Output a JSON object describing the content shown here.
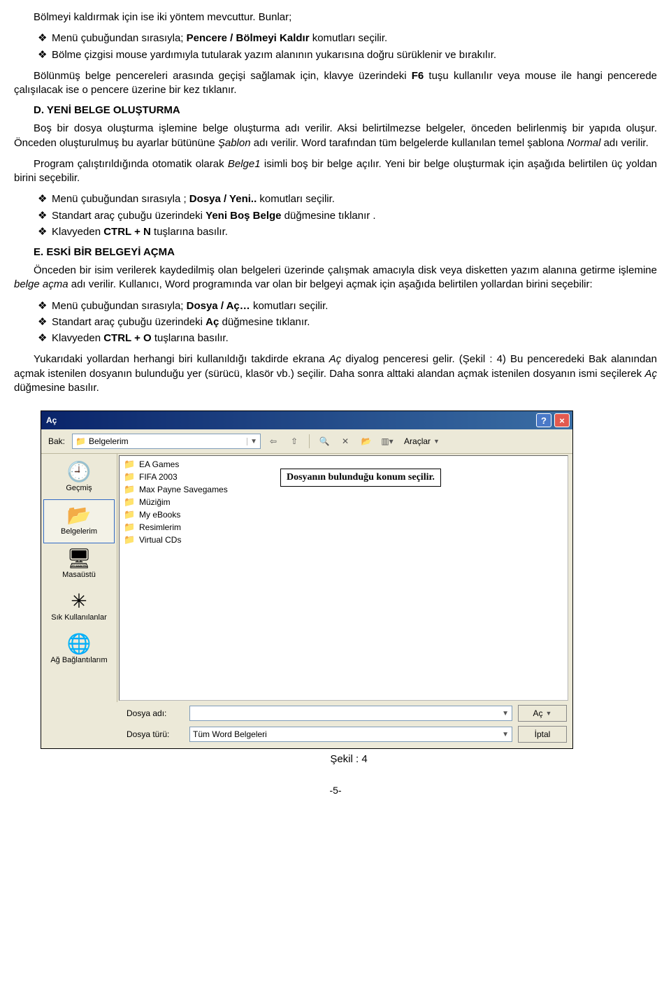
{
  "text": {
    "p1": "Bölmeyi kaldırmak için ise iki yöntem mevcuttur. Bunlar;",
    "b1a": "Menü çubuğundan sırasıyla; ",
    "b1a_bold": "Pencere / Bölmeyi Kaldır",
    "b1a_tail": " komutları seçilir.",
    "b1b": "Bölme çizgisi mouse yardımıyla tutularak yazım alanının yukarısına doğru sürüklenir ve bırakılır.",
    "p2a": "Bölünmüş belge pencereleri arasında geçişi sağlamak için, klavye üzerindeki ",
    "p2_bold": "F6",
    "p2b": " tuşu kullanılır veya mouse ile hangi pencerede çalışılacak ise o pencere üzerine bir kez tıklanır.",
    "hD": "D. YENİ BELGE OLUŞTURMA",
    "p3a": "Boş bir dosya oluşturma işlemine belge oluşturma adı verilir. Aksi belirtilmezse belgeler, önceden belirlenmiş bir yapıda oluşur. Önceden oluşturulmuş bu ayarlar bütününe ",
    "p3_i1": "Şablon",
    "p3b": " adı verilir. Word tarafından tüm belgelerde kullanılan temel şablona ",
    "p3_i2": "Normal",
    "p3c": " adı verilir.",
    "p4a": "Program çalıştırıldığında otomatik olarak ",
    "p4_i": "Belge1",
    "p4b": " isimli boş bir belge açılır. Yeni bir belge oluşturmak için aşağıda belirtilen üç yoldan birini seçebilir.",
    "b2a_pre": "Menü çubuğundan sırasıyla ; ",
    "b2a_bold": "Dosya / Yeni..",
    "b2a_tail": "  komutları seçilir.",
    "b2b_pre": "Standart araç çubuğu üzerindeki ",
    "b2b_bold": "Yeni Boş Belge",
    "b2b_tail": " düğmesine tıklanır .",
    "b2c_pre": "Klavyeden ",
    "b2c_bold": "CTRL + N",
    "b2c_tail": " tuşlarına basılır.",
    "hE": "E. ESKİ BİR BELGEYİ AÇMA",
    "p5a": "Önceden bir isim verilerek kaydedilmiş olan belgeleri üzerinde çalışmak amacıyla disk veya disketten yazım alanına getirme işlemine ",
    "p5_i": "belge açma",
    "p5b": " adı verilir. Kullanıcı, Word programında var olan bir belgeyi açmak için aşağıda belirtilen yollardan birini seçebilir:",
    "b3a_pre": "Menü çubuğundan sırasıyla; ",
    "b3a_bold": "Dosya / Aç…",
    "b3a_tail": " komutları seçilir.",
    "b3b_pre": "Standart araç çubuğu üzerindeki ",
    "b3b_bold": "Aç",
    "b3b_tail": " düğmesine tıklanır.",
    "b3c_pre": "Klavyeden ",
    "b3c_bold": "CTRL + O",
    "b3c_tail": " tuşlarına basılır.",
    "p6a": "Yukarıdaki yollardan herhangi biri kullanıldığı takdirde ekrana ",
    "p6_i": "Aç",
    "p6b": " diyalog penceresi gelir. (Şekil : 4) Bu penceredeki Bak alanından açmak istenilen dosyanın bulunduğu yer (sürücü, klasör vb.) seçilir. Daha sonra alttaki alandan açmak istenilen dosyanın ismi seçilerek ",
    "p6_i2": "Aç",
    "p6c": " düğmesine basılır.",
    "caption": "Şekil : 4",
    "pagenum": "-5-"
  },
  "dialog": {
    "title": "Aç",
    "bak_label": "Bak:",
    "bak_value": "Belgelerim",
    "tools_label": "Araçlar",
    "places": [
      {
        "label": "Geçmiş",
        "icon": "🕘"
      },
      {
        "label": "Belgelerim",
        "icon": "📂",
        "selected": true
      },
      {
        "label": "Masaüstü",
        "icon": "🖥"
      },
      {
        "label": "Sık Kullanılanlar",
        "icon": "✳"
      },
      {
        "label": "Ağ Bağlantılarım",
        "icon": "🌐"
      }
    ],
    "files": [
      {
        "name": "EA Games",
        "icon": "📁"
      },
      {
        "name": "FIFA 2003",
        "icon": "📁"
      },
      {
        "name": "Max Payne Savegames",
        "icon": "📁"
      },
      {
        "name": "Müziğim",
        "icon": "📁"
      },
      {
        "name": "My eBooks",
        "icon": "📁"
      },
      {
        "name": "Resimlerim",
        "icon": "📁"
      },
      {
        "name": "Virtual CDs",
        "icon": "📁"
      }
    ],
    "callout": "Dosyanın bulunduğu konum seçilir.",
    "filename_label": "Dosya adı:",
    "filename_value": "",
    "filetype_label": "Dosya türü:",
    "filetype_value": "Tüm Word Belgeleri",
    "open_btn": "Aç",
    "cancel_btn": "İptal"
  }
}
